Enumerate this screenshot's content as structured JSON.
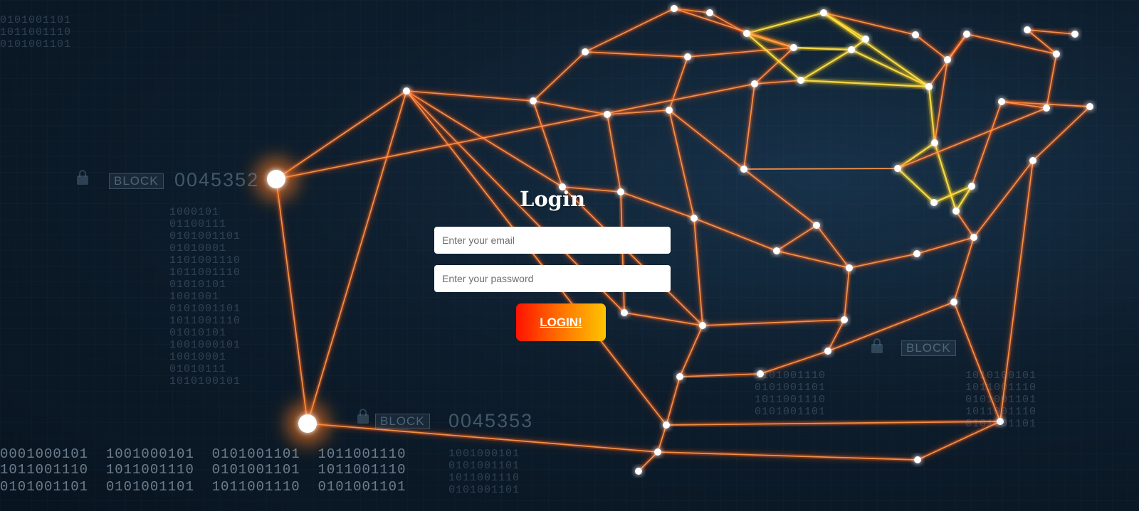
{
  "login": {
    "title": "Login",
    "email_placeholder": "Enter your email",
    "password_placeholder": "Enter your password",
    "button_label": "LOGIN!"
  },
  "background": {
    "block_labels": [
      "BLOCK",
      "BLOCK",
      "BLOCK"
    ],
    "block_numbers": [
      "0045352",
      "0045353"
    ],
    "binary_columns": [
      "1000101\n01100111\n0101001101\n01010001\n1101001110\n1011001110\n01010101\n1001001\n0101001101\n1011001110\n01010101\n1001000101\n10010001\n01010111\n1010100101",
      "1001000101\n0101001101\n1011001110\n0101001101",
      "1010100101\n1011001110\n0101001101\n1011001110\n0101001101",
      "0101001101\n1011001110\n0101001101",
      "1101001110\n0101001101\n1011001110\n0101001101"
    ],
    "binary_rows": [
      "0001000101  1001000101  0101001101  1011001110",
      "1011001110  1011001110  0101001101  1011001110",
      "0101001101  0101001101  1011001110  0101001101"
    ],
    "accent_colors": [
      "#ff4a12",
      "#ff8a1c",
      "#ffd21a",
      "#ffffff"
    ]
  }
}
